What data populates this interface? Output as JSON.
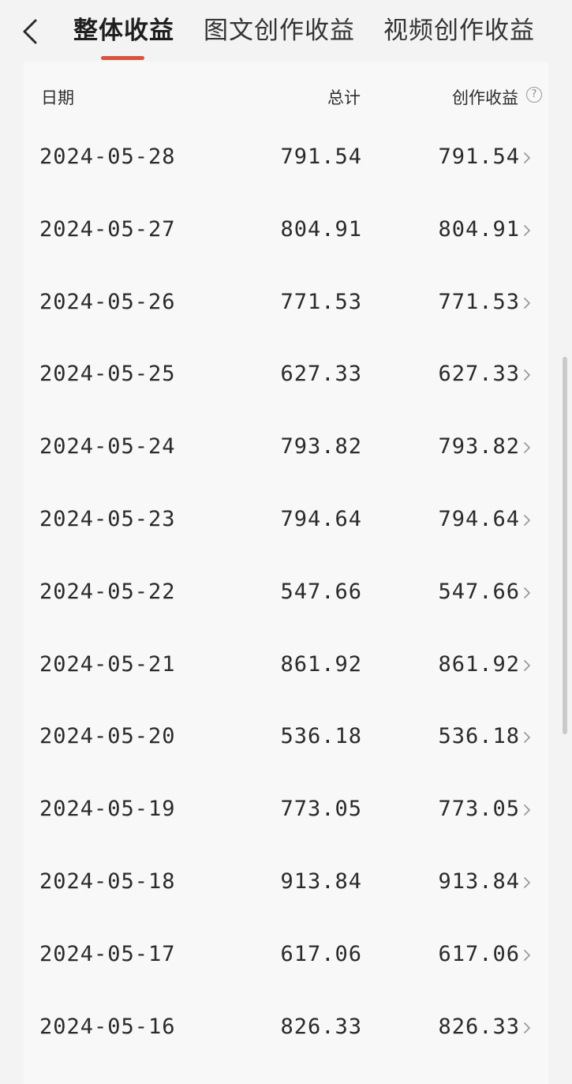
{
  "tabs": [
    {
      "label": "整体收益",
      "active": true
    },
    {
      "label": "图文创作收益",
      "active": false
    },
    {
      "label": "视频创作收益",
      "active": false
    }
  ],
  "colors": {
    "accent": "#d9533f",
    "background": "#f2f3f2",
    "card": "#f7f8f7"
  },
  "table": {
    "headers": {
      "date": "日期",
      "total": "总计",
      "earnings": "创作收益"
    },
    "rows": [
      {
        "date": "2024-05-28",
        "total": "791.54",
        "earnings": "791.54"
      },
      {
        "date": "2024-05-27",
        "total": "804.91",
        "earnings": "804.91"
      },
      {
        "date": "2024-05-26",
        "total": "771.53",
        "earnings": "771.53"
      },
      {
        "date": "2024-05-25",
        "total": "627.33",
        "earnings": "627.33"
      },
      {
        "date": "2024-05-24",
        "total": "793.82",
        "earnings": "793.82"
      },
      {
        "date": "2024-05-23",
        "total": "794.64",
        "earnings": "794.64"
      },
      {
        "date": "2024-05-22",
        "total": "547.66",
        "earnings": "547.66"
      },
      {
        "date": "2024-05-21",
        "total": "861.92",
        "earnings": "861.92"
      },
      {
        "date": "2024-05-20",
        "total": "536.18",
        "earnings": "536.18"
      },
      {
        "date": "2024-05-19",
        "total": "773.05",
        "earnings": "773.05"
      },
      {
        "date": "2024-05-18",
        "total": "913.84",
        "earnings": "913.84"
      },
      {
        "date": "2024-05-17",
        "total": "617.06",
        "earnings": "617.06"
      },
      {
        "date": "2024-05-16",
        "total": "826.33",
        "earnings": "826.33"
      }
    ]
  },
  "icons": {
    "back": "back-chevron-icon",
    "help": "help-question-icon",
    "row_arrow": "chevron-right-icon"
  }
}
